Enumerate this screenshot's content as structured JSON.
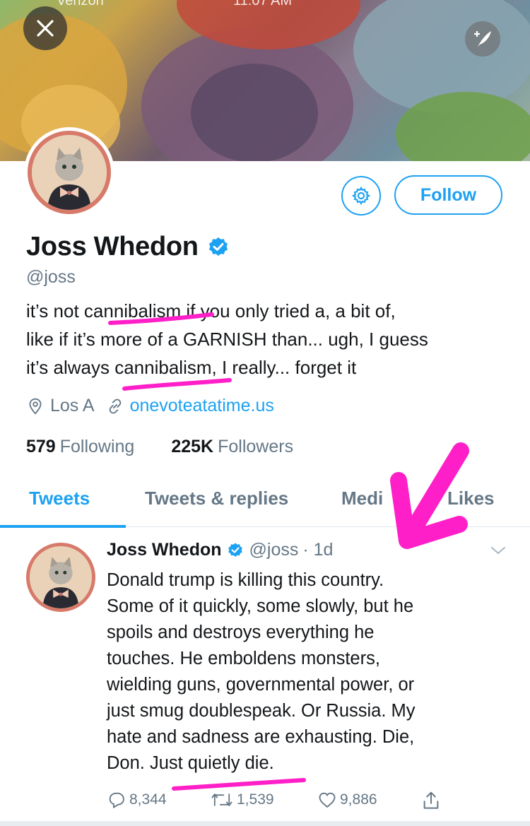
{
  "header": {
    "status_carrier": "Verizon",
    "status_time": "11:07 AM",
    "colors": {
      "accent": "#1da1f2",
      "annotation": "#ff1fc8"
    }
  },
  "profile": {
    "follow_label": "Follow",
    "name": "Joss Whedon",
    "handle": "@joss",
    "bio_lines": [
      "it’s not cannibalism if you only tried a, a bit of,",
      "like if it’s more of a GARNISH than... ugh, I guess",
      "it’s always cannibalism, I really... forget it"
    ],
    "location": "Los A",
    "website": "onevoteatatime.us",
    "following_count": "579",
    "following_label": "Following",
    "followers_count": "225K",
    "followers_label": "Followers"
  },
  "tabs": [
    {
      "label": "Tweets"
    },
    {
      "label": "Tweets & replies"
    },
    {
      "label": "Medi"
    },
    {
      "label": "Likes"
    }
  ],
  "tweet": {
    "name": "Joss Whedon",
    "handle": "@joss",
    "time": "· 1d",
    "lines": [
      "Donald trump is killing this country.",
      "Some of it quickly, some slowly, but he",
      "spoils and destroys everything he",
      "touches. He emboldens monsters,",
      "wielding guns, governmental power, or",
      "just smug doublespeak. Or Russia.  My",
      "hate and sadness are exhausting. Die,",
      "Don. Just quietly die."
    ],
    "replies": "8,344",
    "retweets": "1,539",
    "likes": "9,886"
  },
  "icons": [
    "close-icon",
    "compose-icon",
    "gear-icon",
    "verified-icon",
    "location-icon",
    "link-icon",
    "reply-icon",
    "retweet-icon",
    "like-icon",
    "share-icon",
    "chevron-down-icon"
  ]
}
